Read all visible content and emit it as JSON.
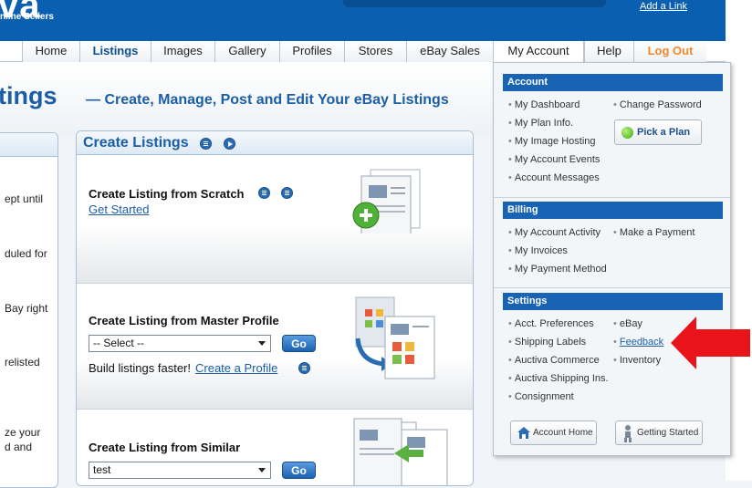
{
  "header": {
    "logo_fragment": "va",
    "logo_tagline": "nline Sellers",
    "add_link": "Add a Link"
  },
  "nav": {
    "tabs": [
      {
        "label": "Home"
      },
      {
        "label": "Listings"
      },
      {
        "label": "Images"
      },
      {
        "label": "Gallery"
      },
      {
        "label": "Profiles"
      },
      {
        "label": "Stores"
      },
      {
        "label": "eBay Sales"
      },
      {
        "label": "My Account"
      },
      {
        "label": "Help"
      },
      {
        "label": "Log Out"
      }
    ]
  },
  "page": {
    "title": "tings",
    "subtitle": "— Create, Manage, Post and Edit Your eBay Listings"
  },
  "left_panel": {
    "fragments": [
      "ept until",
      "duled for",
      "Bay right",
      "relisted",
      "ze your",
      "d and"
    ]
  },
  "create_panel": {
    "title": "Create Listings",
    "scratch": {
      "title": "Create Listing from Scratch",
      "link": "Get Started"
    },
    "profile": {
      "title": "Create Listing from Master Profile",
      "select_value": "-- Select --",
      "go": "Go",
      "text": "Build listings faster!",
      "link": "Create a Profile"
    },
    "similar": {
      "title": "Create Listing from Similar",
      "select_value": "test",
      "go": "Go"
    }
  },
  "dropdown": {
    "account": {
      "heading": "Account",
      "left_items": [
        "My Dashboard",
        "My Plan Info.",
        "My Image Hosting",
        "My Account Events",
        "Account Messages"
      ],
      "right_items": [
        "Change Password"
      ],
      "pick_plan": "Pick a Plan"
    },
    "billing": {
      "heading": "Billing",
      "left_items": [
        "My Account Activity",
        "My Invoices",
        "My Payment Method"
      ],
      "right_items": [
        "Make a Payment"
      ]
    },
    "settings": {
      "heading": "Settings",
      "left_items": [
        "Acct. Preferences",
        "Shipping Labels",
        "Auctiva Commerce",
        "Auctiva Shipping Ins.",
        "Consignment"
      ],
      "right_items": [
        "eBay",
        "Feedback",
        "Inventory"
      ]
    },
    "account_home": "Account Home",
    "getting_started": "Getting Started"
  },
  "colors": {
    "brand_blue": "#0b5fb0",
    "dropdown_heading": "#1863b3",
    "logout": "#f0882c",
    "callout_arrow": "#e8141a"
  }
}
